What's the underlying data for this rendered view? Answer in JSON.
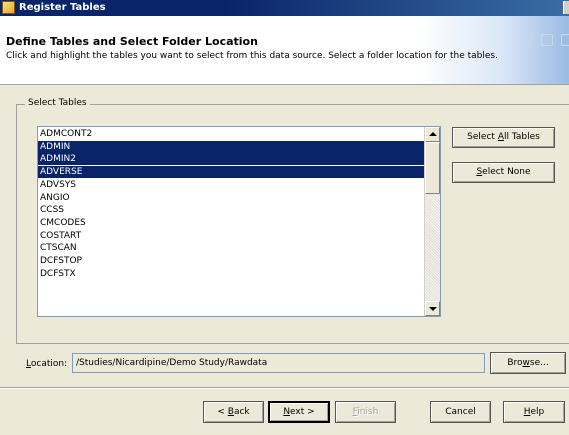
{
  "window": {
    "title": "Register Tables"
  },
  "header": {
    "title": "Define Tables and Select Folder Location",
    "description": "Click and highlight the tables you want to select from this data source.  Select a folder location for the tables."
  },
  "group": {
    "label": "Select Tables"
  },
  "tables": [
    {
      "name": "ADMCONT2",
      "selected": false
    },
    {
      "name": "ADMIN",
      "selected": true
    },
    {
      "name": "ADMIN2",
      "selected": true
    },
    {
      "name": "ADVERSE",
      "selected": true
    },
    {
      "name": "ADVSYS",
      "selected": false
    },
    {
      "name": "ANGIO",
      "selected": false
    },
    {
      "name": "CCSS",
      "selected": false
    },
    {
      "name": "CMCODES",
      "selected": false
    },
    {
      "name": "COSTART",
      "selected": false
    },
    {
      "name": "CTSCAN",
      "selected": false
    },
    {
      "name": "DCFSTOP",
      "selected": false
    },
    {
      "name": "DCFSTX",
      "selected": false
    }
  ],
  "buttons": {
    "select_all": {
      "pre": "Select ",
      "key": "A",
      "post": "ll Tables"
    },
    "select_none": {
      "pre": "",
      "key": "S",
      "post": "elect None"
    },
    "browse": {
      "pre": "Bro",
      "key": "w",
      "post": "se..."
    },
    "back": {
      "pre": "< ",
      "key": "B",
      "post": "ack"
    },
    "next": {
      "pre": "",
      "key": "N",
      "post": "ext >"
    },
    "finish": {
      "pre": "",
      "key": "F",
      "post": "inish"
    },
    "cancel": {
      "pre": "",
      "key": "",
      "post": "Cancel"
    },
    "help": {
      "pre": "",
      "key": "H",
      "post": "elp"
    }
  },
  "location": {
    "label_pre": "",
    "label_key": "L",
    "label_post": "ocation:",
    "value": "/Studies/Nicardipine/Demo Study/Rawdata"
  },
  "colors": {
    "selection": "#0a246a",
    "titlebar": "#0a246a",
    "dialog": "#ece9d8"
  }
}
